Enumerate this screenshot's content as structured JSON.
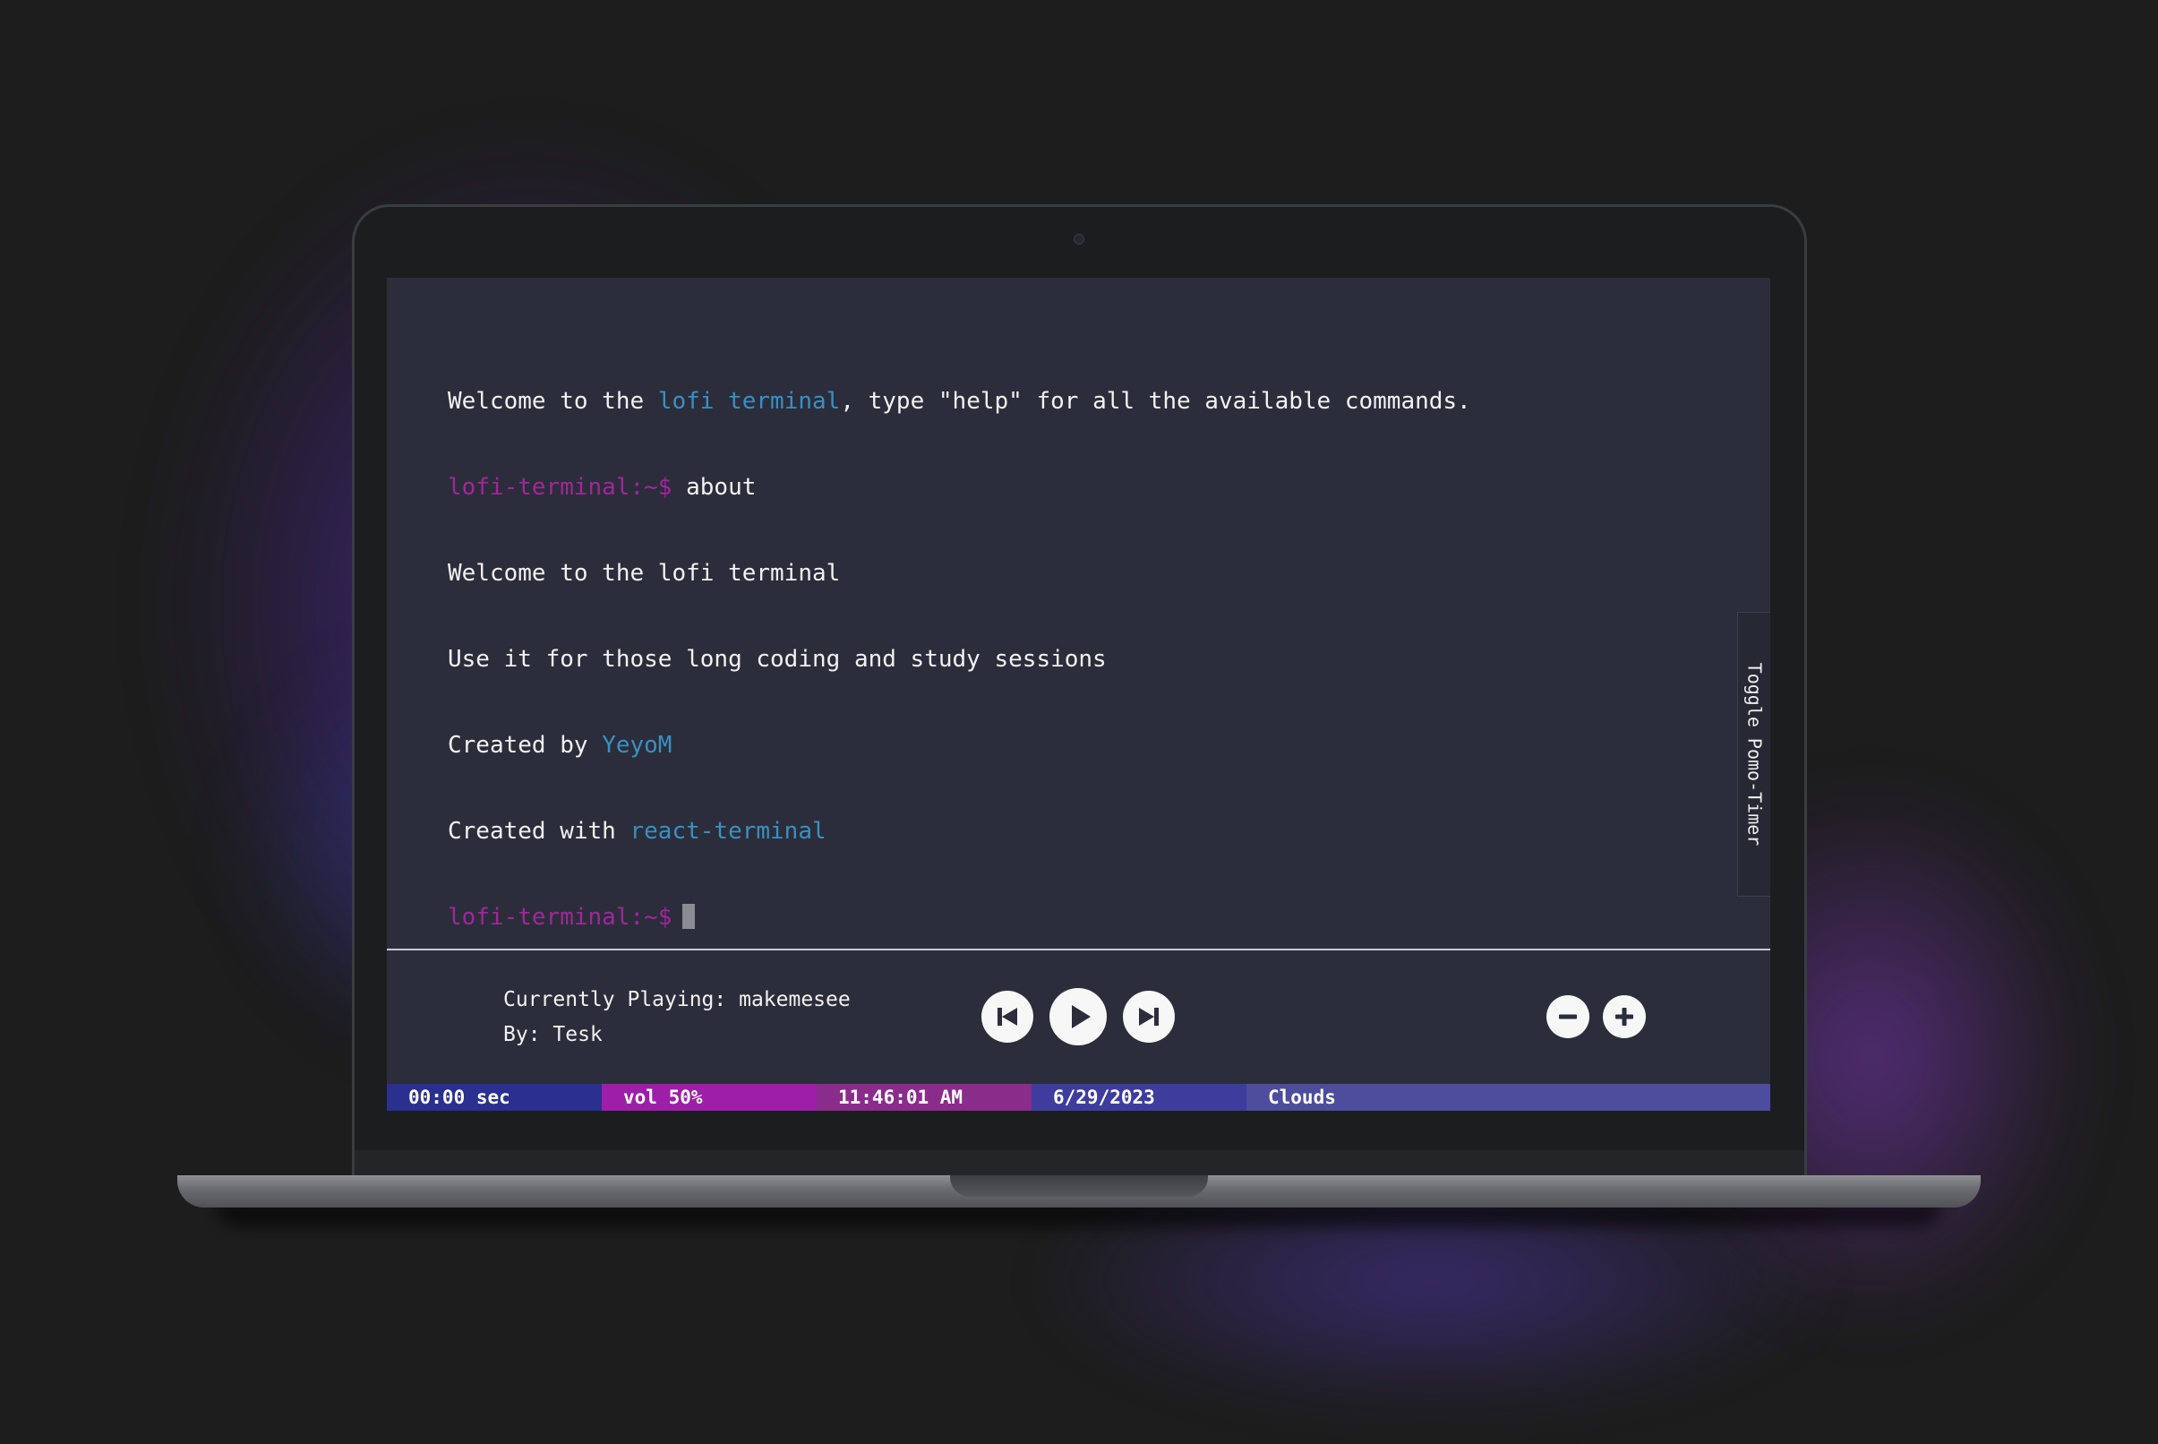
{
  "terminal": {
    "welcome_prefix": "Welcome to the ",
    "welcome_link": "lofi terminal",
    "welcome_suffix": ", type \"help\" for all the available commands.",
    "prompt": "lofi-terminal:~$",
    "command": "about",
    "output": [
      "Welcome to the lofi terminal",
      "Use it for those long coding and study sessions"
    ],
    "created_by_label": "Created by ",
    "created_by_link": "YeyoM",
    "created_with_label": "Created with ",
    "created_with_link": "react-terminal"
  },
  "pomo_toggle": {
    "label": "Toggle Pomo-Timer"
  },
  "player": {
    "currently_playing_label": "Currently Playing: makemesee",
    "artist_label": "By: Tesk",
    "controls": {
      "previous_icon": "skip-previous-icon",
      "play_icon": "play-icon",
      "next_icon": "skip-next-icon",
      "volume_down_icon": "minus-icon",
      "volume_up_icon": "plus-icon"
    }
  },
  "statusbar": {
    "timer": "00:00 sec",
    "volume": "vol 50%",
    "time": "11:46:01 AM",
    "date": "6/29/2023",
    "weather": "Clouds"
  },
  "colors": {
    "screen_bg": "#2b2d3b",
    "link": "#3b8fc2",
    "prompt": "#a2269a",
    "status_timer": "#2b2f8f",
    "status_volume": "#9d1fa8",
    "status_time": "#8a2c8a",
    "status_date": "#3e3d9d",
    "status_weather": "#4d4c9d"
  }
}
